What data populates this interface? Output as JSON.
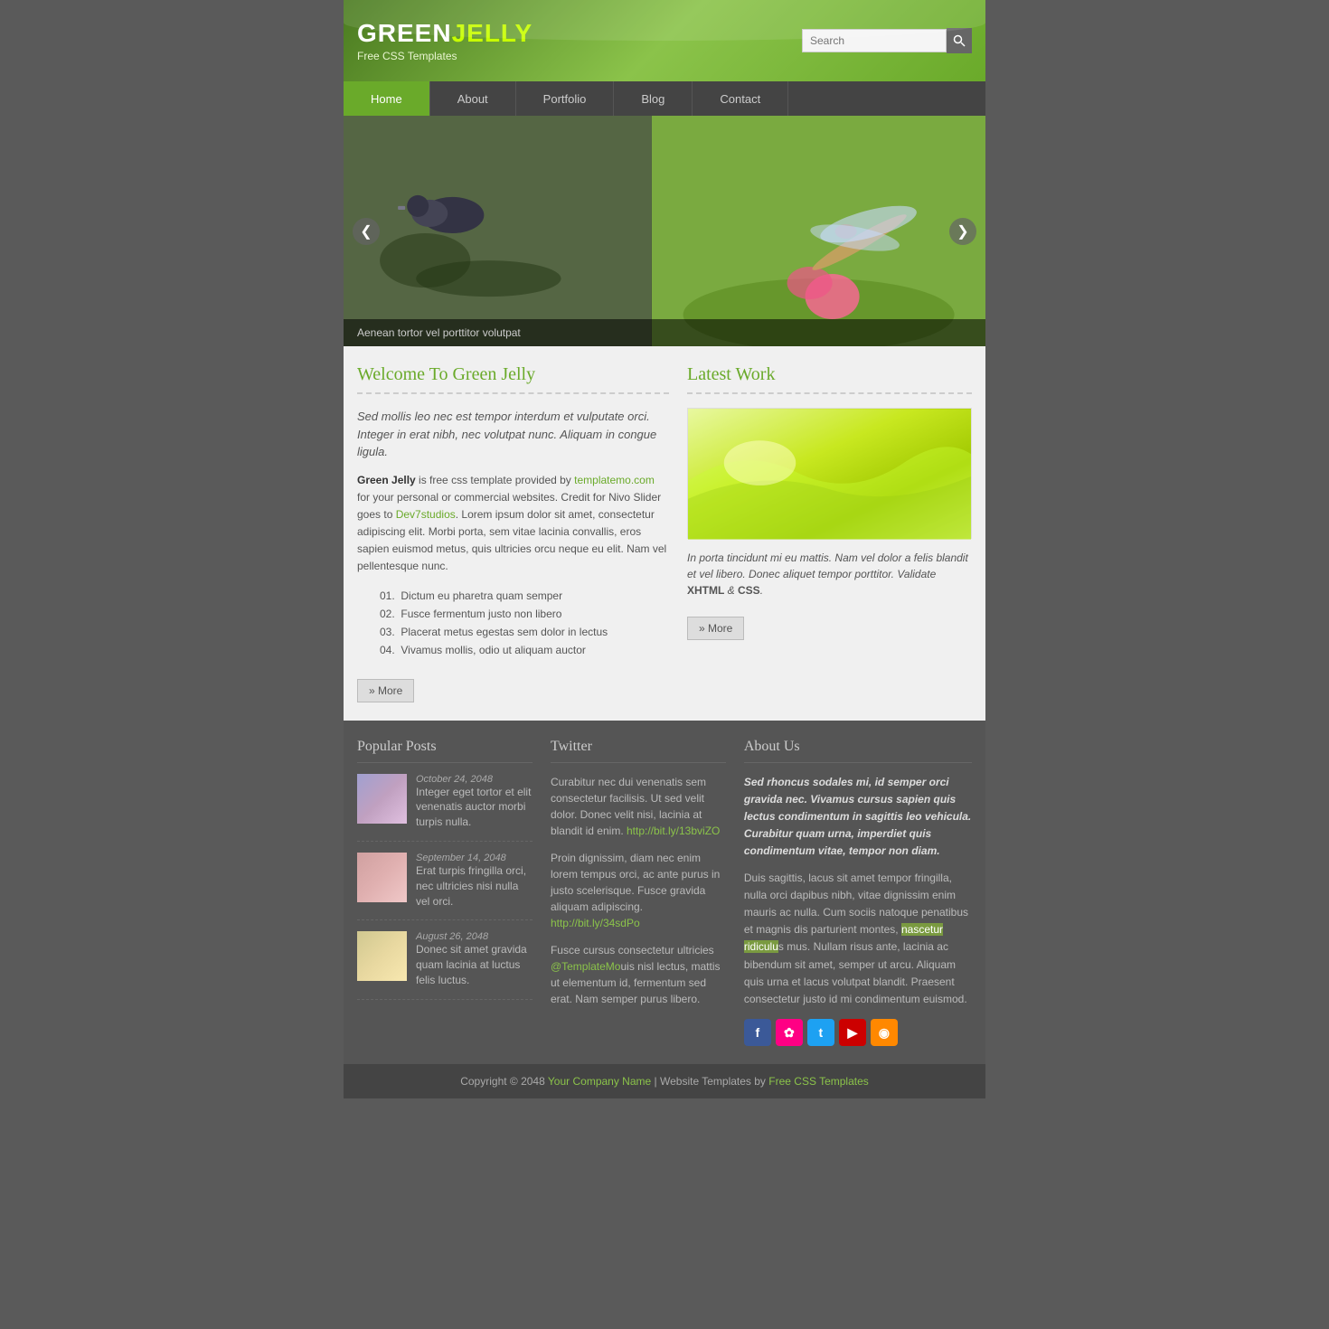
{
  "header": {
    "logo_green": "GREEN",
    "logo_jelly": "JELLY",
    "logo_sub": "Free CSS Templates",
    "search_placeholder": "Search"
  },
  "nav": {
    "items": [
      {
        "label": "Home",
        "active": true
      },
      {
        "label": "About"
      },
      {
        "label": "Portfolio"
      },
      {
        "label": "Blog"
      },
      {
        "label": "Contact"
      }
    ]
  },
  "slider": {
    "caption": "Aenean tortor vel porttitor volutpat",
    "prev_icon": "❮",
    "next_icon": "❯"
  },
  "welcome": {
    "title": "Welcome To Green Jelly",
    "intro": "Sed mollis leo nec est tempor interdum et vulputate orci. Integer in erat nibh, nec volutpat nunc. Aliquam in congue ligula.",
    "body1": " is free css template provided by ",
    "body1_link": "templatemo.com",
    "body2": " for your personal or commercial websites. Credit for Nivo Slider goes to ",
    "body2_link": "Dev7studios",
    "body3": ". Lorem ipsum dolor sit amet, consectetur adipiscing elit. Morbi porta, sem vitae lacinia convallis, eros sapien euismod metus, quis ultricies orcu neque eu elit. Nam vel pellentesque nunc.",
    "list": [
      {
        "num": "01.",
        "text": "Dictum eu pharetra quam semper"
      },
      {
        "num": "02.",
        "text": "Fusce fermentum justo non libero"
      },
      {
        "num": "03.",
        "text": "Placerat metus egestas sem dolor in lectus"
      },
      {
        "num": "04.",
        "text": "Vivamus mollis, odio ut aliquam auctor"
      }
    ],
    "more_label": "» More"
  },
  "latest_work": {
    "title": "Latest Work",
    "caption": "In porta tincidunt mi eu mattis. Nam vel dolor a felis blandit et vel libero. Donec aliquet tempor porttitor. Validate ",
    "xhtml": "XHTML",
    "and": " & ",
    "css": "CSS",
    "more_label": "» More"
  },
  "popular_posts": {
    "title": "Popular Posts",
    "items": [
      {
        "date": "October 24, 2048",
        "text": "Integer eget tortor et elit venenatis auctor morbi turpis nulla."
      },
      {
        "date": "September 14, 2048",
        "text": "Erat turpis fringilla orci, nec ultricies nisi nulla vel orci."
      },
      {
        "date": "August 26, 2048",
        "text": "Donec sit amet gravida quam lacinia at luctus felis luctus."
      }
    ]
  },
  "twitter": {
    "title": "Twitter",
    "tweets": [
      {
        "text": "Curabitur nec dui venenatis sem consectetur facilisis. Ut sed velit dolor. Donec velit nisi, lacinia at blandit id enim. ",
        "link": "http://bit.ly/13bviZO"
      },
      {
        "text": "Proin dignissim, diam nec enim lorem tempus orci, ac ante purus in justo scelerisque. Fusce gravida aliquam adipiscing. ",
        "link": "http://bit.ly/34sdPo"
      },
      {
        "text": "Fusce cursus consectetur ultricies ",
        "handle": "@TemplateMo",
        "text2": "uis nisl lectus, mattis ut elementum id, fermentum sed erat. Nam semper purus libero."
      }
    ]
  },
  "about_us": {
    "title": "About Us",
    "para1": "Sed rhoncus sodales mi, id semper orci gravida nec. Vivamus cursus sapien quis lectus condimentum in sagittis leo vehicula. Curabitur quam urna, imperdiet quis condimentum vitae, tempor non diam.",
    "para2_before": "Duis sagittis, lacus sit amet tempor fringilla, nulla orci dapibus nibh, vitae dignissim enim mauris ac nulla. Cum sociis natoque penatibus et magnis dis parturient montes, ",
    "highlight": "nascetur ridiculu",
    "para2_after": "s mus. Nullam risus ante, lacinia ac bibendum sit amet, semper ut arcu. Aliquam quis urna et lacus volutpat blandit. Praesent consectetur justo id mi condimentum euismod.",
    "social": {
      "facebook": "f",
      "flickr": "✿",
      "twitter": "t",
      "youtube": "▶",
      "rss": "◉"
    }
  },
  "footer": {
    "copyright": "Copyright © 2048 ",
    "company": "Your Company Name",
    "sep": " | ",
    "templates_text": "Website Templates by ",
    "templates_link": "Free CSS Templates"
  }
}
